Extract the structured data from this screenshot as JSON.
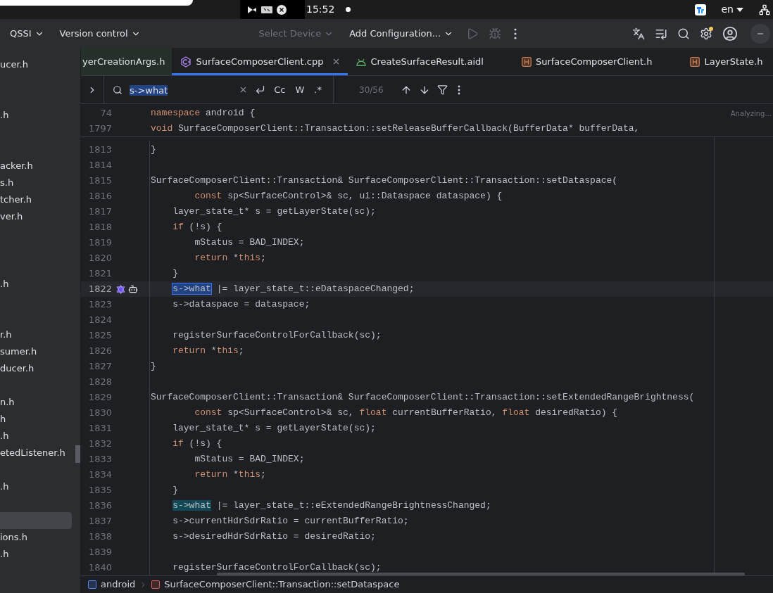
{
  "system_bar": {
    "clock": "15:52",
    "language": "en"
  },
  "toolbar": {
    "items": [
      {
        "kind": "menu",
        "label": "QSSI",
        "disabled": false
      },
      {
        "kind": "menu",
        "label": "Version control",
        "disabled": false
      },
      {
        "kind": "spacer"
      },
      {
        "kind": "menu",
        "label": "Select Device",
        "disabled": true
      },
      {
        "kind": "menu",
        "label": "Add Configuration...",
        "disabled": false
      },
      {
        "kind": "run",
        "disabled": true
      },
      {
        "kind": "debug",
        "disabled": true
      },
      {
        "kind": "more",
        "disabled": false
      },
      {
        "kind": "spacer"
      },
      {
        "kind": "translate",
        "disabled": false
      },
      {
        "kind": "list",
        "disabled": false
      },
      {
        "kind": "search",
        "disabled": false
      },
      {
        "kind": "settings",
        "disabled": false,
        "notification": true
      },
      {
        "kind": "account",
        "disabled": false
      },
      {
        "kind": "minimize",
        "disabled": false
      }
    ]
  },
  "sidebar": {
    "items": [
      {
        "label": "ucer.h",
        "selected": false
      },
      {
        "label": ".h",
        "selected": false
      },
      {
        "label": "acker.h",
        "selected": false
      },
      {
        "label": "s.h",
        "selected": false
      },
      {
        "label": "tcher.h",
        "selected": false
      },
      {
        "label": "ver.h",
        "selected": false
      },
      {
        "label": ".h",
        "selected": false
      },
      {
        "label": "r.h",
        "selected": false
      },
      {
        "label": "sumer.h",
        "selected": false
      },
      {
        "label": "ducer.h",
        "selected": false
      },
      {
        "label": "n.h",
        "selected": false
      },
      {
        "label": "h",
        "selected": false
      },
      {
        "label": ".h",
        "selected": false
      },
      {
        "label": "etedListener.h",
        "selected": false
      },
      {
        "label": ".h",
        "selected": false
      },
      {
        "selected": true
      },
      {
        "label": "ions.h",
        "selected": false
      },
      {
        "label": ".h",
        "selected": false
      }
    ]
  },
  "tabs": [
    {
      "label": "yerCreationArgs.h",
      "kind": "none",
      "selected": false
    },
    {
      "label": "SurfaceComposerClient.cpp",
      "kind": "cpp",
      "selected": true
    },
    {
      "label": "CreateSurfaceResult.aidl",
      "kind": "android",
      "selected": false
    },
    {
      "label": "SurfaceComposerClient.h",
      "kind": "header",
      "selected": false
    },
    {
      "label": "LayerState.h",
      "kind": "header",
      "selected": false
    }
  ],
  "find_bar": {
    "value": "s->what",
    "options": [
      "Cc",
      "W",
      ".*"
    ],
    "count": "30/56"
  },
  "editor": {
    "status": "Analyzing...",
    "sticky_lines": [
      {
        "number": "74",
        "segments": [
          {
            "kind": "keyword",
            "text": "namespace"
          },
          {
            "kind": "plain",
            "text": " android {"
          }
        ]
      },
      {
        "number": "1797",
        "segments": [
          {
            "kind": "keyword",
            "text": "void"
          },
          {
            "kind": "plain",
            "text": " SurfaceComposerClient::Transaction::setReleaseBufferCallback(BufferData* bufferData,"
          }
        ]
      }
    ],
    "lines": [
      {
        "number": "1813",
        "current": false,
        "segments": [
          {
            "kind": "plain",
            "text": "}"
          }
        ]
      },
      {
        "number": "1814",
        "current": false
      },
      {
        "number": "1815",
        "current": false,
        "segments": [
          {
            "kind": "plain",
            "text": "SurfaceComposerClient::Transaction& SurfaceComposerClient::Transaction::setDataspace("
          }
        ]
      },
      {
        "number": "1816",
        "current": false,
        "segments": [
          {
            "kind": "keyword",
            "text": "        const"
          },
          {
            "kind": "plain",
            "text": " sp<SurfaceControl>& sc, ui::Dataspace dataspace) {"
          }
        ]
      },
      {
        "number": "1817",
        "current": false,
        "segments": [
          {
            "kind": "plain",
            "text": "    layer_state_t* s = getLayerState(sc);"
          }
        ]
      },
      {
        "number": "1818",
        "current": false,
        "segments": [
          {
            "kind": "keyword",
            "text": "    if"
          },
          {
            "kind": "plain",
            "text": " (!s) {"
          }
        ]
      },
      {
        "number": "1819",
        "current": false,
        "segments": [
          {
            "kind": "plain",
            "text": "        mStatus = BAD_INDEX;"
          }
        ]
      },
      {
        "number": "1820",
        "current": false,
        "segments": [
          {
            "kind": "keyword",
            "text": "        return"
          },
          {
            "kind": "plain",
            "text": " *"
          },
          {
            "kind": "keyword",
            "text": "this"
          },
          {
            "kind": "plain",
            "text": ";"
          }
        ]
      },
      {
        "number": "1821",
        "current": false,
        "segments": [
          {
            "kind": "plain",
            "text": "    }"
          }
        ]
      },
      {
        "number": "1822",
        "current": true,
        "segments": [
          {
            "kind": "match_selected",
            "text": "    s->what"
          },
          {
            "kind": "plain",
            "text": " |= layer_state_t::eDataspaceChanged;"
          }
        ]
      },
      {
        "number": "1823",
        "current": false,
        "segments": [
          {
            "kind": "plain",
            "text": "    s->dataspace = dataspace;"
          }
        ]
      },
      {
        "number": "1824",
        "current": false
      },
      {
        "number": "1825",
        "current": false,
        "segments": [
          {
            "kind": "plain",
            "text": "    registerSurfaceControlForCallback(sc);"
          }
        ]
      },
      {
        "number": "1826",
        "current": false,
        "segments": [
          {
            "kind": "keyword",
            "text": "    return"
          },
          {
            "kind": "plain",
            "text": " *"
          },
          {
            "kind": "keyword",
            "text": "this"
          },
          {
            "kind": "plain",
            "text": ";"
          }
        ]
      },
      {
        "number": "1827",
        "current": false,
        "segments": [
          {
            "kind": "plain",
            "text": "}"
          }
        ]
      },
      {
        "number": "1828",
        "current": false
      },
      {
        "number": "1829",
        "current": false,
        "segments": [
          {
            "kind": "plain",
            "text": "SurfaceComposerClient::Transaction& SurfaceComposerClient::Transaction::setExtendedRangeBrightness("
          }
        ]
      },
      {
        "number": "1830",
        "current": false,
        "segments": [
          {
            "kind": "keyword",
            "text": "        const"
          },
          {
            "kind": "plain",
            "text": " sp<SurfaceControl>& sc, "
          },
          {
            "kind": "keyword",
            "text": "float"
          },
          {
            "kind": "plain",
            "text": " currentBufferRatio, "
          },
          {
            "kind": "keyword",
            "text": "float"
          },
          {
            "kind": "plain",
            "text": " desiredRatio) {"
          }
        ]
      },
      {
        "number": "1831",
        "current": false,
        "segments": [
          {
            "kind": "plain",
            "text": "    layer_state_t* s = getLayerState(sc);"
          }
        ]
      },
      {
        "number": "1832",
        "current": false,
        "segments": [
          {
            "kind": "keyword",
            "text": "    if"
          },
          {
            "kind": "plain",
            "text": " (!s) {"
          }
        ]
      },
      {
        "number": "1833",
        "current": false,
        "segments": [
          {
            "kind": "plain",
            "text": "        mStatus = BAD_INDEX;"
          }
        ]
      },
      {
        "number": "1834",
        "current": false,
        "segments": [
          {
            "kind": "keyword",
            "text": "        return"
          },
          {
            "kind": "plain",
            "text": " *"
          },
          {
            "kind": "keyword",
            "text": "this"
          },
          {
            "kind": "plain",
            "text": ";"
          }
        ]
      },
      {
        "number": "1835",
        "current": false,
        "segments": [
          {
            "kind": "plain",
            "text": "    }"
          }
        ]
      },
      {
        "number": "1836",
        "current": false,
        "segments": [
          {
            "kind": "match",
            "text": "    s->what"
          },
          {
            "kind": "plain",
            "text": " |= layer_state_t::eExtendedRangeBrightnessChanged;"
          }
        ]
      },
      {
        "number": "1837",
        "current": false,
        "segments": [
          {
            "kind": "plain",
            "text": "    s->currentHdrSdrRatio = currentBufferRatio;"
          }
        ]
      },
      {
        "number": "1838",
        "current": false,
        "segments": [
          {
            "kind": "plain",
            "text": "    s->desiredHdrSdrRatio = desiredRatio;"
          }
        ]
      },
      {
        "number": "1839",
        "current": false
      },
      {
        "number": "1840",
        "current": false,
        "segments": [
          {
            "kind": "plain",
            "text": "    registerSurfaceControlForCallback(sc);"
          }
        ]
      }
    ]
  },
  "breadcrumb": [
    {
      "kind": "namespace",
      "label": "android"
    },
    {
      "kind": "function",
      "label": "SurfaceComposerClient::Transaction::setDataspace"
    }
  ]
}
